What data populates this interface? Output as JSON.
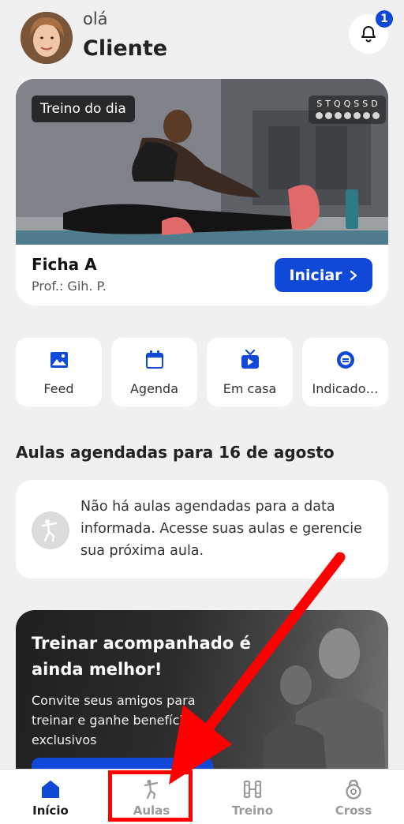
{
  "header": {
    "greeting": "olá",
    "user_name": "Cliente",
    "notification_count": "1"
  },
  "hero": {
    "tag": "Treino do dia",
    "week_days": "STQQSSD",
    "workout_name": "Ficha A",
    "instructor": "Prof.: Gih. P.",
    "start_label": "Iniciar"
  },
  "quick_actions": [
    {
      "label": "Feed",
      "icon": "image-icon"
    },
    {
      "label": "Agenda",
      "icon": "calendar-icon"
    },
    {
      "label": "Em casa",
      "icon": "tv-icon"
    },
    {
      "label": "Indicado…",
      "icon": "gift-icon"
    }
  ],
  "classes": {
    "title": "Aulas agendadas para 16 de agosto",
    "empty_message": "Não há aulas agendadas para a data informada. Acesse suas aulas e gerencie sua próxima aula."
  },
  "promo": {
    "title": "Treinar acompanhado é ainda melhor!",
    "text": "Convite seus amigos para treinar e ganhe benefícios exclusivos"
  },
  "tabs": [
    {
      "label": "Início",
      "icon": "home-icon",
      "active": true
    },
    {
      "label": "Aulas",
      "icon": "class-icon",
      "active": false
    },
    {
      "label": "Treino",
      "icon": "dumbbell-icon",
      "active": false
    },
    {
      "label": "Cross",
      "icon": "kettlebell-icon",
      "active": false
    }
  ],
  "colors": {
    "accent": "#1049d8",
    "annotation": "#ff0000",
    "background": "#f0f0f0"
  }
}
